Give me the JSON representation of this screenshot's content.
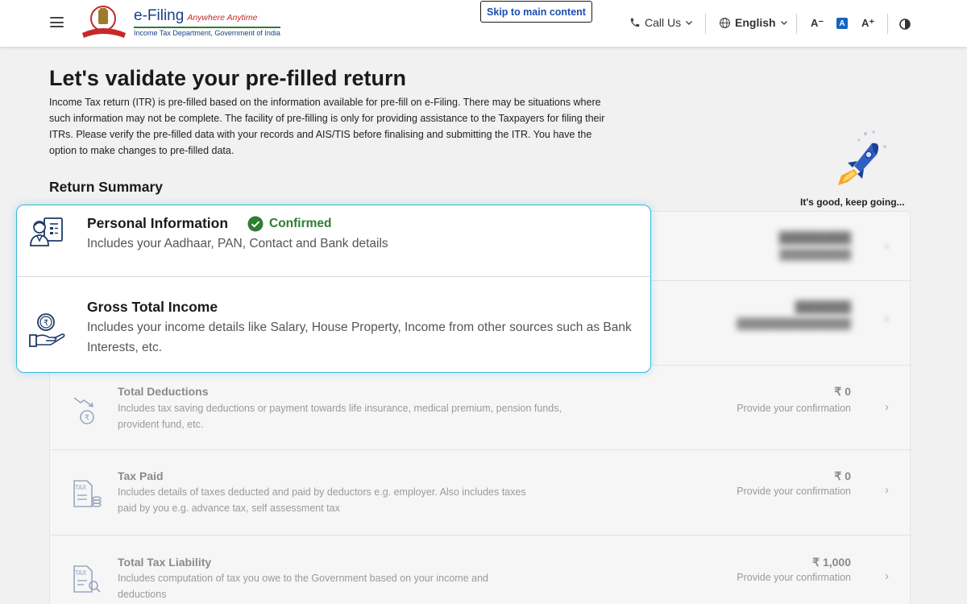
{
  "header": {
    "brand_title": "e-Filing",
    "brand_tagline": "Anywhere Anytime",
    "brand_dept": "Income Tax Department, Government of India",
    "skip_link": "Skip to main content",
    "call_us": "Call Us",
    "language": "English",
    "font_decrease": "A⁻",
    "font_default": "A",
    "font_increase": "A⁺",
    "icons": [
      "hamburger-icon",
      "phone-icon",
      "globe-icon",
      "chevron-down-icon",
      "contrast-icon"
    ]
  },
  "main": {
    "title": "Let's validate your pre-filled return",
    "intro": "Income Tax return (ITR) is pre-filled based on the information available for pre-fill on e-Filing. There may be situations where such information may not be complete. The facility of pre-filling is only for providing assistance to the Taxpayers for filing their ITRs. Please verify the pre-filled data with your records and AIS/TIS before finalising and submitting the ITR. You have the option to make changes to pre-filled data.",
    "summary_title": "Return Summary",
    "encourage": "It's good, keep going..."
  },
  "popup": {
    "personal": {
      "title": "Personal Information",
      "status": "Confirmed",
      "desc": "Includes your Aadhaar, PAN, Contact and Bank details"
    },
    "income": {
      "title": "Gross Total Income",
      "desc": "Includes your income details like Salary, House Property, Income from other sources such as Bank Interests, etc."
    }
  },
  "rows": [
    {
      "title": "Total Deductions",
      "desc": "Includes tax saving deductions or payment towards life insurance, medical premium, pension funds, provident fund, etc.",
      "amount": "₹ 0",
      "status": "Provide your confirmation"
    },
    {
      "title": "Tax Paid",
      "desc": "Includes details of taxes deducted and paid by deductors e.g. employer. Also includes taxes paid by you e.g. advance tax, self assessment tax",
      "amount": "₹ 0",
      "status": "Provide your confirmation"
    },
    {
      "title": "Total Tax Liability",
      "desc": "Includes computation of tax you owe to the Government based on your income and deductions",
      "amount": "₹ 1,000",
      "status": "Provide your confirmation"
    }
  ],
  "colors": {
    "accent_blue": "#1565c0",
    "popup_border": "#39b7dd",
    "confirmed_green": "#2e7d32"
  }
}
